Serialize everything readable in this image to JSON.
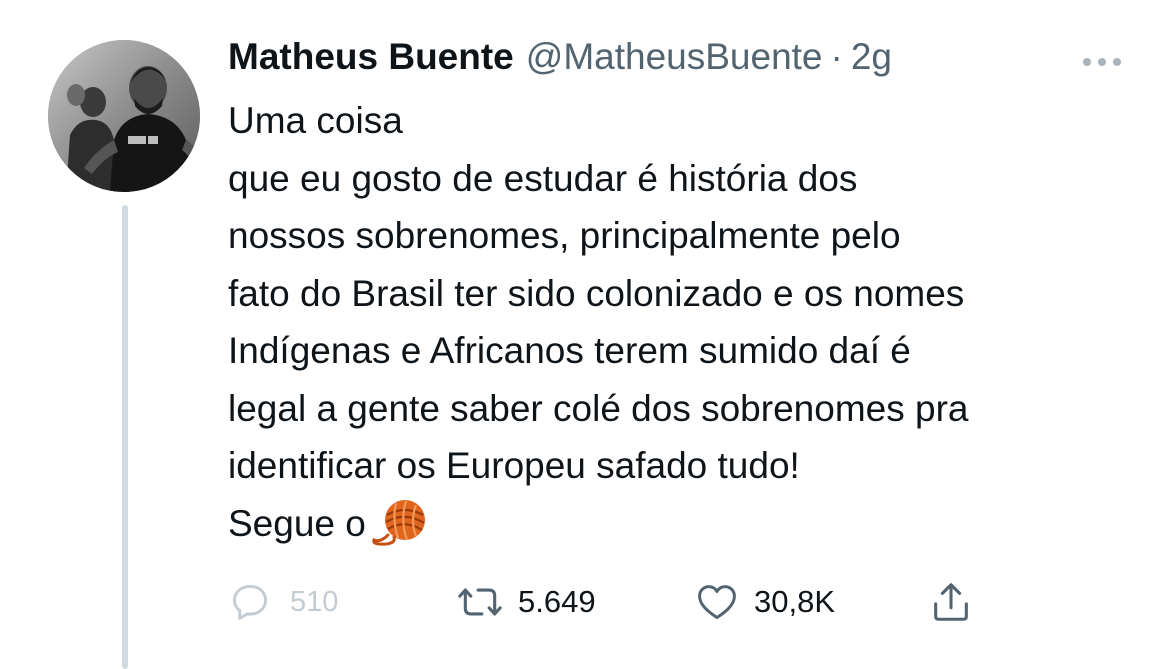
{
  "tweet": {
    "author_name": "Matheus Buente",
    "handle": "@MatheusBuente",
    "separator": "·",
    "time": "2g",
    "more_menu_icon": "more-horizontal-icon",
    "text_lines": [
      "Uma coisa",
      "que eu gosto de estudar é história dos",
      "nossos sobrenomes, principalmente pelo",
      "fato do Brasil ter sido colonizado e os nomes",
      "Indígenas e Africanos terem sumido daí é",
      "legal a gente saber colé dos sobrenomes pra",
      "identificar os Europeu safado tudo!",
      "Segue o"
    ],
    "emoji": "yarn-ball-emoji",
    "actions": {
      "reply": {
        "icon": "reply-icon",
        "count": "510"
      },
      "retweet": {
        "icon": "retweet-icon",
        "count": "5.649"
      },
      "like": {
        "icon": "heart-icon",
        "count": "30,8K"
      },
      "share": {
        "icon": "share-icon"
      }
    }
  },
  "colors": {
    "text": "#0f1419",
    "secondary": "#536471",
    "thread_line": "#cfd9de",
    "yarn": "#e0651d"
  }
}
